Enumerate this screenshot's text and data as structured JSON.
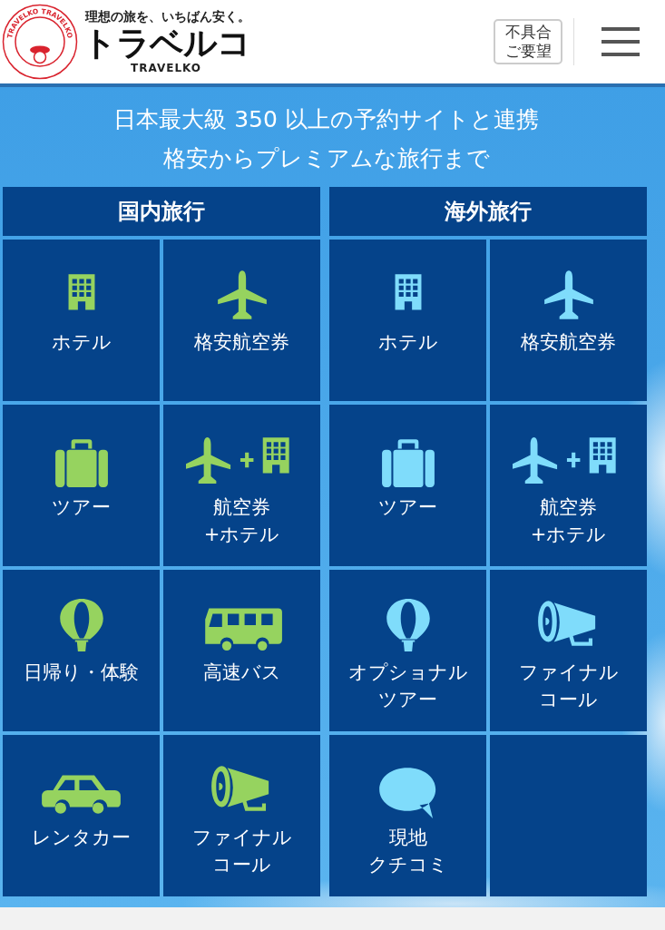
{
  "header": {
    "logo": {
      "ring_text": "TRAVELKO TRAVELKO",
      "tagline": "理想の旅を、いちばん安く。",
      "name": "トラベルコ",
      "romaji": "TRAVELKO"
    },
    "feedback_button": "不具合ご要望"
  },
  "headline": [
    "日本最大級 350 以上の予約サイトと連携",
    "格安からプレミアムな旅行まで"
  ],
  "columns": [
    {
      "title": "国内旅行",
      "color": "#96d35f",
      "tiles": [
        {
          "kind": "hotel",
          "label": "ホテル"
        },
        {
          "kind": "plane",
          "label": "格安航空券"
        },
        {
          "kind": "suitcase",
          "label": "ツアー"
        },
        {
          "kind": "plane-hotel",
          "label": [
            "航空券",
            "+ホテル"
          ]
        },
        {
          "kind": "balloon",
          "label": "日帰り・体験"
        },
        {
          "kind": "bus",
          "label": "高速バス"
        },
        {
          "kind": "car",
          "label": "レンタカー"
        },
        {
          "kind": "megaphone",
          "label": [
            "ファイナル",
            "コール"
          ]
        }
      ]
    },
    {
      "title": "海外旅行",
      "color": "#7fdcfb",
      "tiles": [
        {
          "kind": "hotel",
          "label": "ホテル"
        },
        {
          "kind": "plane",
          "label": "格安航空券"
        },
        {
          "kind": "suitcase",
          "label": "ツアー"
        },
        {
          "kind": "plane-hotel",
          "label": [
            "航空券",
            "+ホテル"
          ]
        },
        {
          "kind": "balloon",
          "label": [
            "オプショナル",
            "ツアー"
          ]
        },
        {
          "kind": "megaphone",
          "label": [
            "ファイナル",
            "コール"
          ]
        },
        {
          "kind": "speech",
          "label": [
            "現地",
            "クチコミ"
          ]
        },
        {
          "kind": "empty"
        }
      ]
    }
  ]
}
